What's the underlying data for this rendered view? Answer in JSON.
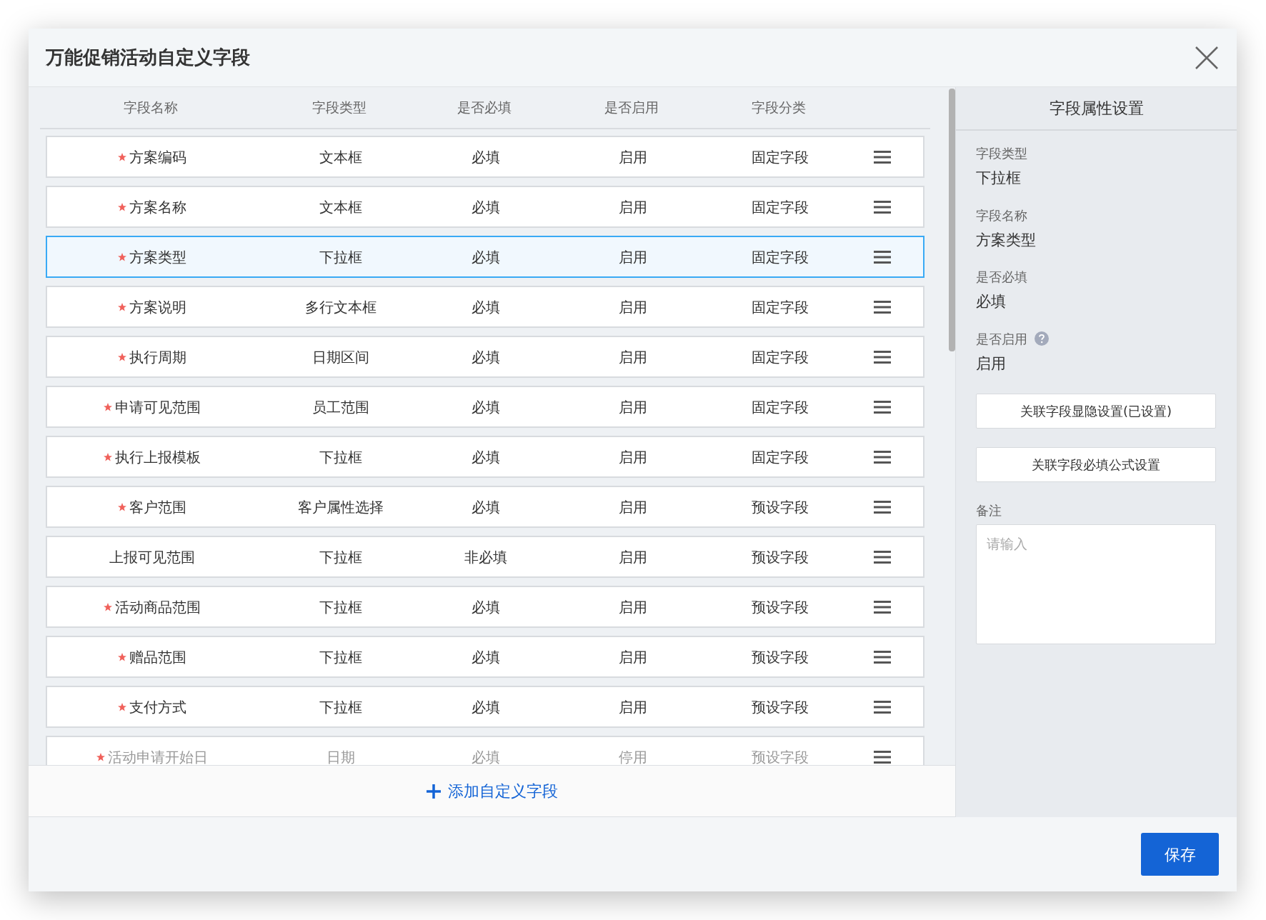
{
  "dialog": {
    "title": "万能促销活动自定义字段"
  },
  "table": {
    "columns": [
      "字段名称",
      "字段类型",
      "是否必填",
      "是否启用",
      "字段分类"
    ],
    "rows": [
      {
        "name": "方案编码",
        "type": "文本框",
        "required_label": "必填",
        "enabled_label": "启用",
        "category": "固定字段",
        "required": true,
        "enabled": true,
        "selected": false
      },
      {
        "name": "方案名称",
        "type": "文本框",
        "required_label": "必填",
        "enabled_label": "启用",
        "category": "固定字段",
        "required": true,
        "enabled": true,
        "selected": false
      },
      {
        "name": "方案类型",
        "type": "下拉框",
        "required_label": "必填",
        "enabled_label": "启用",
        "category": "固定字段",
        "required": true,
        "enabled": true,
        "selected": true
      },
      {
        "name": "方案说明",
        "type": "多行文本框",
        "required_label": "必填",
        "enabled_label": "启用",
        "category": "固定字段",
        "required": true,
        "enabled": true,
        "selected": false
      },
      {
        "name": "执行周期",
        "type": "日期区间",
        "required_label": "必填",
        "enabled_label": "启用",
        "category": "固定字段",
        "required": true,
        "enabled": true,
        "selected": false
      },
      {
        "name": "申请可见范围",
        "type": "员工范围",
        "required_label": "必填",
        "enabled_label": "启用",
        "category": "固定字段",
        "required": true,
        "enabled": true,
        "selected": false
      },
      {
        "name": "执行上报模板",
        "type": "下拉框",
        "required_label": "必填",
        "enabled_label": "启用",
        "category": "固定字段",
        "required": true,
        "enabled": true,
        "selected": false
      },
      {
        "name": "客户范围",
        "type": "客户属性选择",
        "required_label": "必填",
        "enabled_label": "启用",
        "category": "预设字段",
        "required": true,
        "enabled": true,
        "selected": false
      },
      {
        "name": "上报可见范围",
        "type": "下拉框",
        "required_label": "非必填",
        "enabled_label": "启用",
        "category": "预设字段",
        "required": false,
        "enabled": true,
        "selected": false
      },
      {
        "name": "活动商品范围",
        "type": "下拉框",
        "required_label": "必填",
        "enabled_label": "启用",
        "category": "预设字段",
        "required": true,
        "enabled": true,
        "selected": false
      },
      {
        "name": "赠品范围",
        "type": "下拉框",
        "required_label": "必填",
        "enabled_label": "启用",
        "category": "预设字段",
        "required": true,
        "enabled": true,
        "selected": false
      },
      {
        "name": "支付方式",
        "type": "下拉框",
        "required_label": "必填",
        "enabled_label": "启用",
        "category": "预设字段",
        "required": true,
        "enabled": true,
        "selected": false
      },
      {
        "name": "活动申请开始日",
        "type": "日期",
        "required_label": "必填",
        "enabled_label": "停用",
        "category": "预设字段",
        "required": true,
        "enabled": false,
        "selected": false
      }
    ]
  },
  "add_button": {
    "label": "添加自定义字段"
  },
  "properties": {
    "title": "字段属性设置",
    "fields": [
      {
        "label": "字段类型",
        "value": "下拉框",
        "help": false
      },
      {
        "label": "字段名称",
        "value": "方案类型",
        "help": false
      },
      {
        "label": "是否必填",
        "value": "必填",
        "help": false
      },
      {
        "label": "是否启用",
        "value": "启用",
        "help": true
      }
    ],
    "buttons": [
      "关联字段显隐设置(已设置)",
      "关联字段必填公式设置"
    ],
    "remark": {
      "label": "备注",
      "placeholder": "请输入"
    }
  },
  "footer": {
    "save": "保存"
  }
}
